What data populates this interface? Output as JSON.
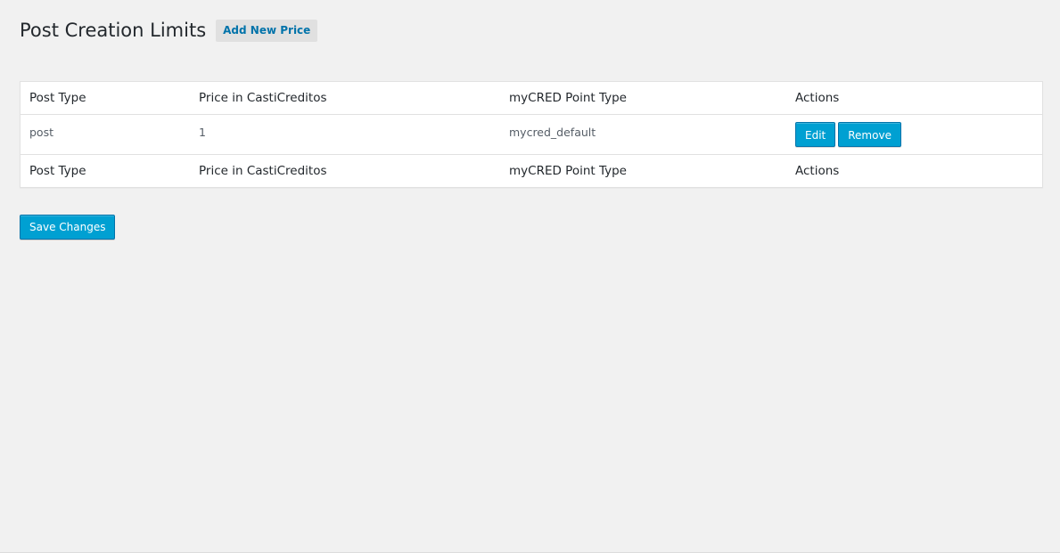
{
  "header": {
    "title": "Post Creation Limits",
    "add_new_label": "Add New Price"
  },
  "table": {
    "columns": [
      "Post Type",
      "Price in CastiCreditos",
      "myCRED Point Type",
      "Actions"
    ],
    "rows": [
      {
        "post_type": "post",
        "price": "1",
        "point_type": "mycred_default",
        "edit_label": "Edit",
        "remove_label": "Remove"
      }
    ]
  },
  "footer": {
    "save_label": "Save Changes"
  },
  "colors": {
    "background": "#f1f1f1",
    "primary_button": "#00a0d2",
    "link": "#0073aa"
  }
}
